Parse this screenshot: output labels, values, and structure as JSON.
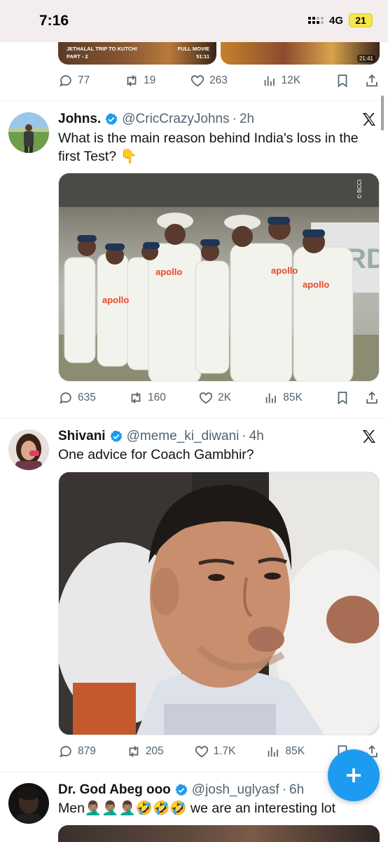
{
  "status_bar": {
    "time": "7:16",
    "network": "4G",
    "battery": "21"
  },
  "previous_tweet": {
    "media_left_caption": "JETHALAL TRIP TO KUTCH!",
    "media_left_part": "PART - 2",
    "media_left_badge": "FULL MOVIE",
    "media_left_duration": "51:11",
    "media_right_duration": "21:41",
    "actions": {
      "replies": "77",
      "reposts": "19",
      "likes": "263",
      "views": "12K"
    }
  },
  "tweets": [
    {
      "name": "Johns.",
      "handle": "@CricCrazyJohns",
      "time": "2h",
      "text": "What is the main reason behind India's loss in the first Test? 👇",
      "media_watermark": "© BCCI",
      "actions": {
        "replies": "635",
        "reposts": "160",
        "likes": "2K",
        "views": "85K"
      }
    },
    {
      "name": "Shivani",
      "handle": "@meme_ki_diwani",
      "time": "4h",
      "text": "One advice for Coach Gambhir?",
      "actions": {
        "replies": "879",
        "reposts": "205",
        "likes": "1.7K",
        "views": "85K"
      }
    },
    {
      "name": "Dr. God Abeg ooo",
      "handle": "@josh_uglyasf",
      "time": "6h",
      "text": "Men🤦🏽‍♂️🤦🏽‍♂️🤦🏽‍♂️🤣🤣🤣 we are an interesting lot"
    }
  ],
  "separator": "·",
  "icons": {
    "reply": "reply-icon",
    "repost": "repost-icon",
    "like": "heart-icon",
    "views": "views-icon",
    "bookmark": "bookmark-icon",
    "share": "share-icon",
    "verified": "verified-badge-icon",
    "grok": "x-logo-icon",
    "compose": "plus-icon"
  },
  "colors": {
    "accent": "#1d9bf0",
    "text_primary": "#0f1419",
    "text_secondary": "#536471"
  }
}
